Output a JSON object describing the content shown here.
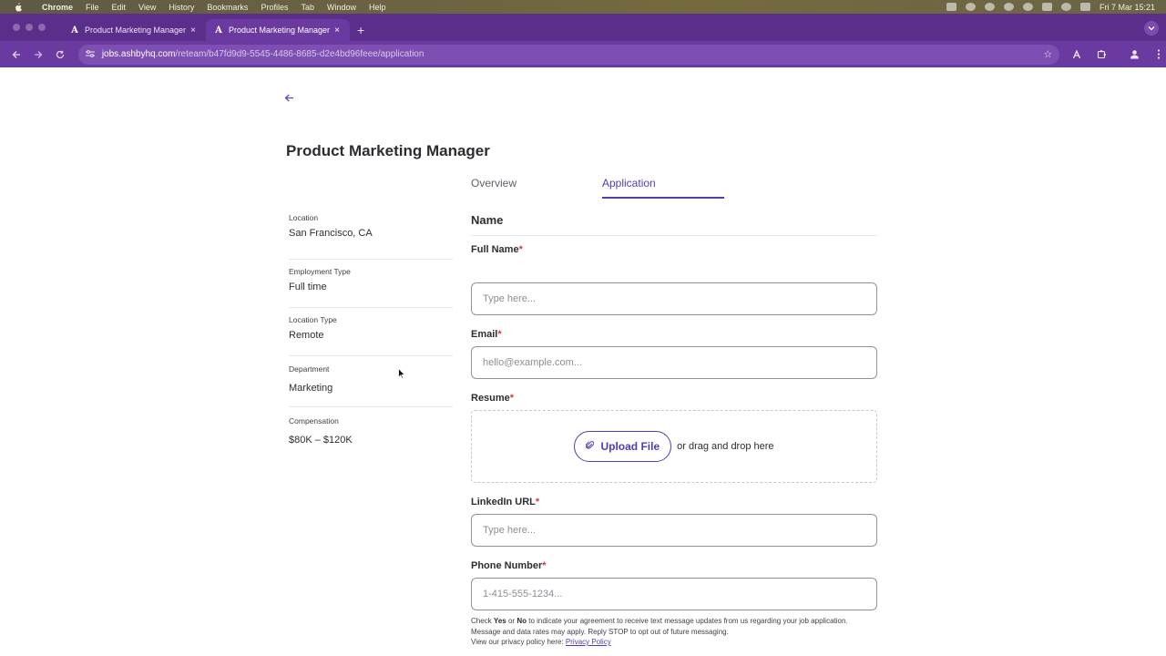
{
  "menubar": {
    "app_name": "Chrome",
    "items": [
      "File",
      "Edit",
      "View",
      "History",
      "Bookmarks",
      "Profiles",
      "Tab",
      "Window",
      "Help"
    ],
    "clock": "Fri 7 Mar  15:21"
  },
  "browser": {
    "tabs": [
      {
        "favicon": "A",
        "title": "Product Marketing Manager",
        "close": "×",
        "active": false
      },
      {
        "favicon": "A",
        "title": "Product Marketing Manager",
        "close": "×",
        "active": true
      }
    ],
    "new_tab": "+",
    "url_host": "jobs.ashbyhq.com",
    "url_path": "/reteam/b47fd9d9-5545-4486-8685-d2e4bd96feee/application"
  },
  "page": {
    "back": "←",
    "job_title": "Product Marketing Manager",
    "tabs": {
      "overview": "Overview",
      "application": "Application",
      "active": "Application"
    },
    "sidebar": [
      {
        "label": "Location",
        "value": "San Francisco, CA"
      },
      {
        "label": "Employment Type",
        "value": "Full time"
      },
      {
        "label": "Location Type",
        "value": "Remote"
      },
      {
        "label": "Department",
        "value": "Marketing"
      },
      {
        "label": "Compensation",
        "value": "$80K – $120K"
      }
    ],
    "form": {
      "section_title": "Name",
      "required_mark": "*",
      "full_name": {
        "label": "Full Name",
        "placeholder": "Type here..."
      },
      "email": {
        "label": "Email",
        "placeholder": "hello@example.com..."
      },
      "resume": {
        "label": "Resume",
        "upload_label": "Upload File",
        "drop_text": "or drag and drop here"
      },
      "linkedin": {
        "label": "LinkedIn URL",
        "placeholder": "Type here..."
      },
      "phone": {
        "label": "Phone Number",
        "placeholder": "1-415-555-1234..."
      },
      "sms_note": {
        "check": "Check",
        "yes": "Yes",
        "or": "or",
        "no": "No",
        "body": "to indicate your agreement to receive text message updates from us regarding your job application. Message and data rates may apply. Reply STOP to opt out of future messaging.",
        "privacy_prefix": "View our privacy policy here:",
        "privacy_link": "Privacy Policy"
      }
    }
  }
}
